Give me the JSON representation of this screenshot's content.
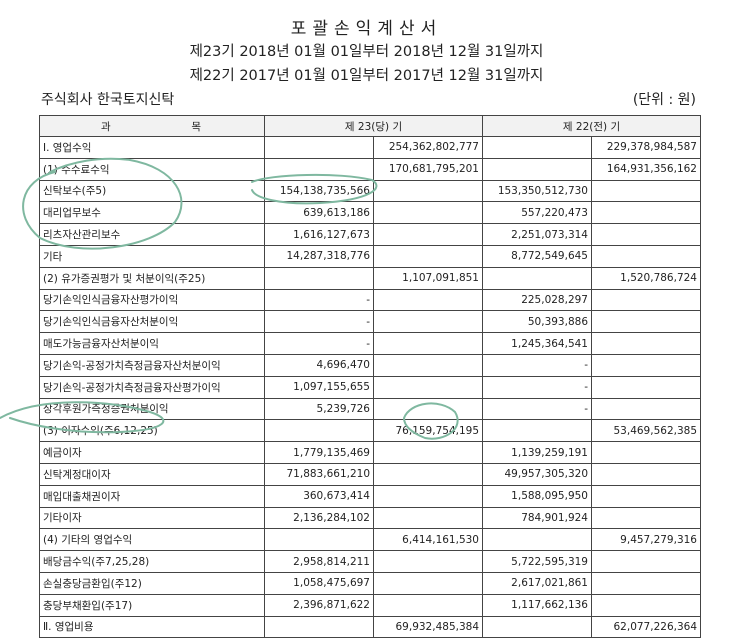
{
  "header": {
    "title": "포괄손익계산서",
    "period_current": "제23기 2018년 01월 01일부터 2018년 12월 31일까지",
    "period_prior": "제22기 2017년 01월 01일부터 2017년 12월 31일까지",
    "company": "주식회사 한국토지신탁",
    "unit": "(단위 : 원)"
  },
  "table": {
    "col_account_a": "과",
    "col_account_b": "목",
    "col_current": "제 23(당) 기",
    "col_prior": "제 22(전) 기",
    "rows": [
      {
        "label": "Ⅰ. 영업수익",
        "c1": "",
        "c2": "254,362,802,777",
        "p1": "",
        "p2": "229,378,984,587"
      },
      {
        "label": "(1) 수수료수익",
        "c1": "",
        "c2": "170,681,795,201",
        "p1": "",
        "p2": "164,931,356,162"
      },
      {
        "label": "신탁보수(주5)",
        "c1": "154,138,735,566",
        "c2": "",
        "p1": "153,350,512,730",
        "p2": ""
      },
      {
        "label": "대리업무보수",
        "c1": "639,613,186",
        "c2": "",
        "p1": "557,220,473",
        "p2": ""
      },
      {
        "label": "리츠자산관리보수",
        "c1": "1,616,127,673",
        "c2": "",
        "p1": "2,251,073,314",
        "p2": ""
      },
      {
        "label": "기타",
        "c1": "14,287,318,776",
        "c2": "",
        "p1": "8,772,549,645",
        "p2": ""
      },
      {
        "label": "(2) 유가증권평가 및 처분이익(주25)",
        "c1": "",
        "c2": "1,107,091,851",
        "p1": "",
        "p2": "1,520,786,724"
      },
      {
        "label": "당기손익인식금융자산평가이익",
        "c1": "-",
        "c2": "",
        "p1": "225,028,297",
        "p2": ""
      },
      {
        "label": "당기손익인식금융자산처분이익",
        "c1": "-",
        "c2": "",
        "p1": "50,393,886",
        "p2": ""
      },
      {
        "label": "매도가능금융자산처분이익",
        "c1": "-",
        "c2": "",
        "p1": "1,245,364,541",
        "p2": ""
      },
      {
        "label": "당기손익-공정가치측정금융자산처분이익",
        "c1": "4,696,470",
        "c2": "",
        "p1": "-",
        "p2": ""
      },
      {
        "label": "당기손익-공정가치측정금융자산평가이익",
        "c1": "1,097,155,655",
        "c2": "",
        "p1": "-",
        "p2": ""
      },
      {
        "label": "상각후원가측정증권처분이익",
        "c1": "5,239,726",
        "c2": "",
        "p1": "-",
        "p2": ""
      },
      {
        "label": "(3) 이자수익(주6,12,25)",
        "c1": "",
        "c2": "76,159,754,195",
        "p1": "",
        "p2": "53,469,562,385"
      },
      {
        "label": "예금이자",
        "c1": "1,779,135,469",
        "c2": "",
        "p1": "1,139,259,191",
        "p2": ""
      },
      {
        "label": "신탁계정대이자",
        "c1": "71,883,661,210",
        "c2": "",
        "p1": "49,957,305,320",
        "p2": ""
      },
      {
        "label": "매입대출채권이자",
        "c1": "360,673,414",
        "c2": "",
        "p1": "1,588,095,950",
        "p2": ""
      },
      {
        "label": "기타이자",
        "c1": "2,136,284,102",
        "c2": "",
        "p1": "784,901,924",
        "p2": ""
      },
      {
        "label": "(4) 기타의 영업수익",
        "c1": "",
        "c2": "6,414,161,530",
        "p1": "",
        "p2": "9,457,279,316"
      },
      {
        "label": "배당금수익(주7,25,28)",
        "c1": "2,958,814,211",
        "c2": "",
        "p1": "5,722,595,319",
        "p2": ""
      },
      {
        "label": "손실충당금환입(주12)",
        "c1": "1,058,475,697",
        "c2": "",
        "p1": "2,617,021,861",
        "p2": ""
      },
      {
        "label": "충당부채환입(주17)",
        "c1": "2,396,871,622",
        "c2": "",
        "p1": "1,117,662,136",
        "p2": ""
      },
      {
        "label": "Ⅱ. 영업비용",
        "c1": "",
        "c2": "69,932,485,384",
        "p1": "",
        "p2": "62,077,226,364"
      }
    ]
  }
}
